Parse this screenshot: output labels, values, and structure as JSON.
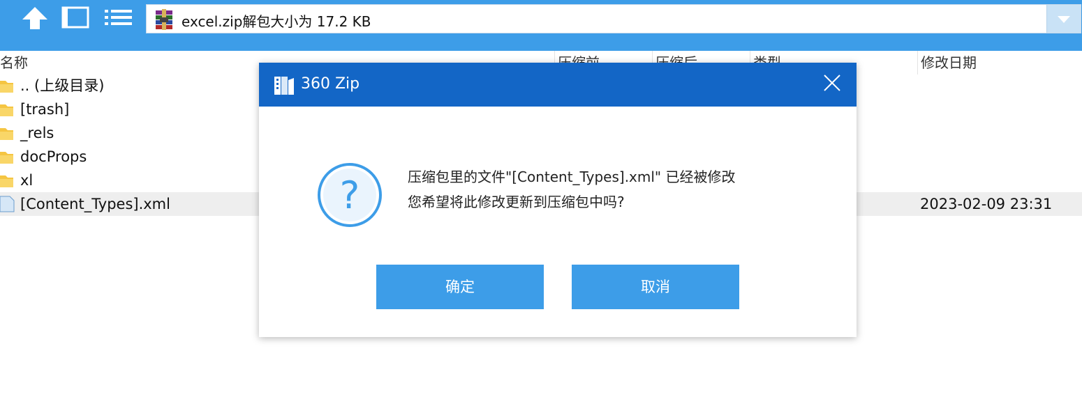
{
  "toolbar": {
    "up_icon": "up-arrow-icon",
    "view_icon": "window-view-icon",
    "list_icon": "list-view-icon",
    "address_text": "excel.zip解包大小为 17.2 KB",
    "archive_icon": "winrar-archive-icon",
    "dropdown_icon": "chevron-down-icon",
    "background_color": "#3d9de8"
  },
  "columns": {
    "name": "名称",
    "packed": "压缩前",
    "compressed": "压缩后",
    "type": "类型",
    "modified": "修改日期"
  },
  "files": [
    {
      "name": ".. (上级目录)",
      "icon": "folder-icon",
      "date": ""
    },
    {
      "name": "[trash]",
      "icon": "folder-icon",
      "date": ""
    },
    {
      "name": "_rels",
      "icon": "folder-icon",
      "date": ""
    },
    {
      "name": "docProps",
      "icon": "folder-icon",
      "date": ""
    },
    {
      "name": "xl",
      "icon": "folder-icon",
      "date": ""
    },
    {
      "name": "[Content_Types].xml",
      "icon": "file-icon",
      "date": "2023-02-09 23:31",
      "selected": true
    }
  ],
  "dialog": {
    "title": "360 Zip",
    "logo_icon": "360zip-logo-icon",
    "close_icon": "close-icon",
    "question_icon": "question-icon",
    "message_line1": "压缩包里的文件\"[Content_Types].xml\" 已经被修改",
    "message_line2": "您希望将此修改更新到压缩包中吗?",
    "ok_label": "确定",
    "cancel_label": "取消",
    "title_color": "#1366c6",
    "button_color": "#3d9de8"
  }
}
